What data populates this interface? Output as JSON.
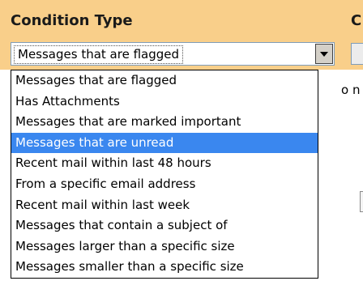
{
  "header": {
    "condition_type_label": "Condition Type",
    "second_column_label": "C"
  },
  "condition_select": {
    "selected_value": "Messages that are flagged",
    "is_open": true,
    "options": [
      "Messages that are flagged",
      "Has Attachments",
      "Messages that are marked important",
      "Messages that are unread",
      "Recent mail within last 48 hours",
      "From a specific email address",
      "Recent mail within last week",
      "Messages that contain a subject of",
      "Messages larger than a specific size",
      "Messages smaller than a specific size"
    ],
    "highlighted_index": 3,
    "arrow_icon": "chevron-down-icon"
  },
  "background_fragments": {
    "partial_text": "o n"
  },
  "colors": {
    "header_background": "#f9cf8a",
    "highlight": "#3a87ef"
  }
}
